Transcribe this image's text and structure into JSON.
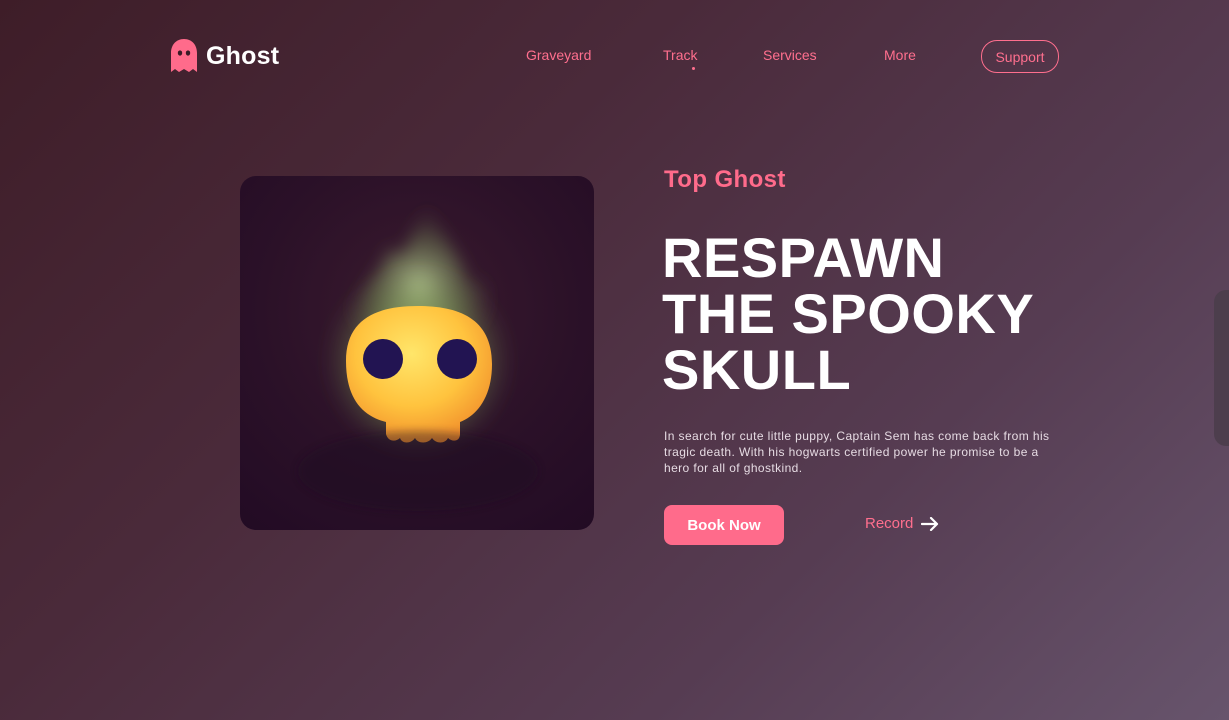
{
  "brand": {
    "name": "Ghost",
    "icon": "ghost-icon",
    "accent": "#ff6b8b"
  },
  "nav": {
    "links": [
      {
        "label": "Graveyard"
      },
      {
        "label": "Track"
      },
      {
        "label": "Services"
      },
      {
        "label": "More"
      }
    ],
    "active": "Track",
    "support_label": "Support"
  },
  "hero": {
    "eyebrow": "Top Ghost",
    "headline": [
      "RESPAWN",
      "THE SPOOKY",
      "SKULL"
    ],
    "description": "In search for cute little puppy, Captain Sem has come back from his tragic death. With his hogwarts certified power he promise to be a hero for all of ghostkind.",
    "book_label": "Book Now",
    "record_label": "Record",
    "record_icon": "arrow-right-icon",
    "image_icon": "flaming-skull-icon"
  }
}
